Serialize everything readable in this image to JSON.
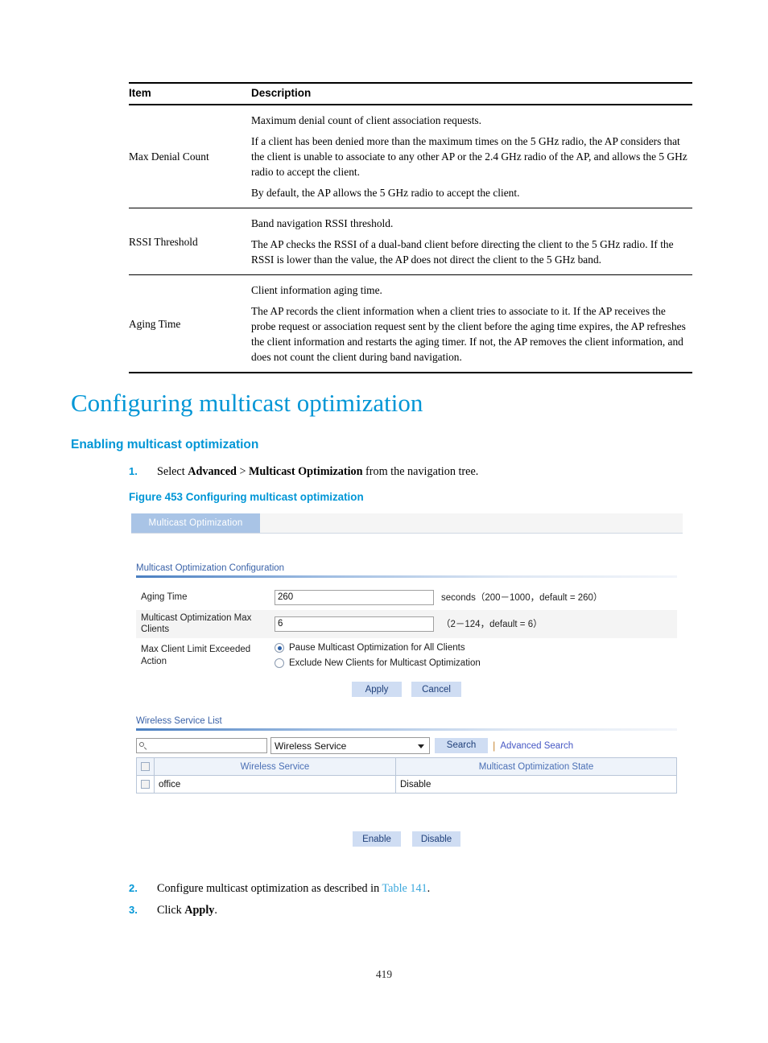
{
  "reference_table": {
    "headers": [
      "Item",
      "Description"
    ],
    "rows": [
      {
        "item": "Max Denial Count",
        "paragraphs": [
          "Maximum denial count of client association requests.",
          "If a client has been denied more than the maximum times on the 5 GHz radio, the AP considers that the client is unable to associate to any other AP or the 2.4 GHz radio of the AP, and allows the 5 GHz radio to accept the client.",
          "By default, the AP allows the 5 GHz radio to accept the client."
        ]
      },
      {
        "item": "RSSI Threshold",
        "paragraphs": [
          "Band navigation RSSI threshold.",
          "The AP checks the RSSI of a dual-band client before directing the client to the 5 GHz radio. If the RSSI is lower than the value, the AP does not direct the client to the 5 GHz band."
        ]
      },
      {
        "item": "Aging Time",
        "paragraphs": [
          "Client information aging time.",
          "The AP records the client information when a client tries to associate to it. If the AP receives the probe request or association request sent by the client before the aging time expires, the AP refreshes the client information and restarts the aging timer. If not, the AP removes the client information, and does not count the client during band navigation."
        ]
      }
    ]
  },
  "headings": {
    "h1": "Configuring multicast optimization",
    "h2": "Enabling multicast optimization"
  },
  "steps": {
    "step1": {
      "number": "1.",
      "prefix": "Select ",
      "bold1": "Advanced",
      "sep": " > ",
      "bold2": "Multicast Optimization",
      "suffix": " from the navigation tree."
    },
    "step2": {
      "number": "2.",
      "prefix": "Configure multicast optimization as described in ",
      "link": "Table 141",
      "suffix": "."
    },
    "step3": {
      "number": "3.",
      "prefix": "Click ",
      "bold": "Apply",
      "suffix": "."
    }
  },
  "figure": {
    "caption": "Figure 453 Configuring multicast optimization",
    "tab_label": "Multicast Optimization",
    "config_section": {
      "title": "Multicast Optimization Configuration",
      "rows": [
        {
          "label": "Aging Time",
          "value": "260",
          "hint": "seconds（200－1000，default = 260）"
        },
        {
          "label": "Multicast Optimization Max Clients",
          "value": "6",
          "hint": "（2－124，default = 6）"
        }
      ],
      "radio_group": {
        "label": "Max Client Limit Exceeded Action",
        "options": [
          {
            "text": "Pause Multicast Optimization for All Clients",
            "selected": true
          },
          {
            "text": "Exclude New Clients for Multicast Optimization",
            "selected": false
          }
        ]
      },
      "apply_label": "Apply",
      "cancel_label": "Cancel"
    },
    "list_section": {
      "title": "Wireless Service List",
      "search_placeholder": "",
      "search_value": "",
      "search_field": "Wireless Service",
      "search_button": "Search",
      "separator": "|",
      "advanced_search": "Advanced Search",
      "columns": [
        "Wireless Service",
        "Multicast Optimization State"
      ],
      "rows": [
        {
          "service": "office",
          "state": "Disable"
        }
      ],
      "enable_label": "Enable",
      "disable_label": "Disable"
    }
  },
  "page_number": "419",
  "colors": {
    "heading_blue": "#0096d6",
    "link_blue": "#3aa7dc",
    "tab_blue": "#a9c4e6",
    "button_blue": "#cfddf3",
    "table_header_blue": "#4a6fb5"
  }
}
